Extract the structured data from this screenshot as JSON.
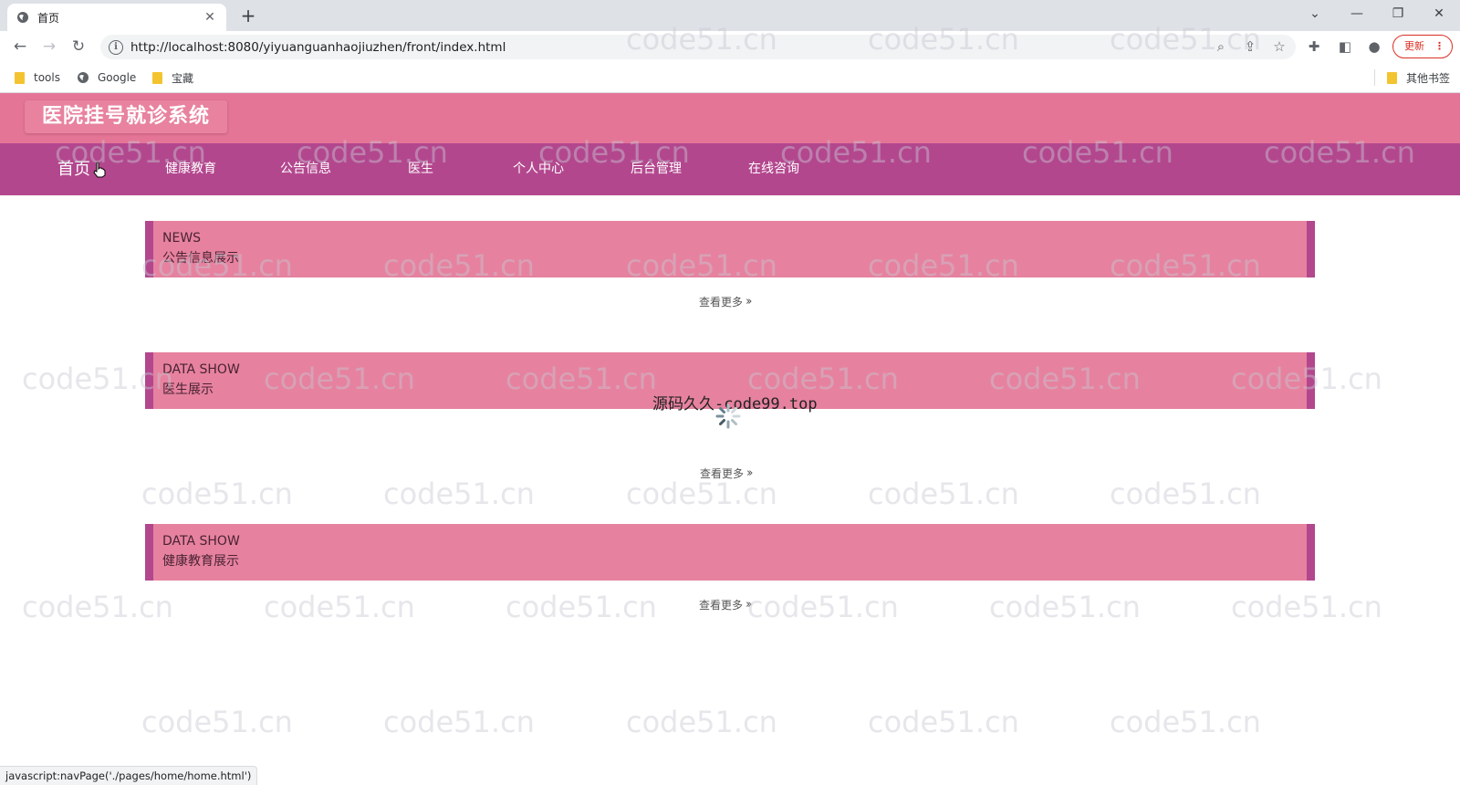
{
  "browser": {
    "tab_title": "首页",
    "tab_close": "✕",
    "new_tab": "+",
    "url": "http://localhost:8080/yiyuanguanhaojiuzhen/front/index.html",
    "update_label": "更新",
    "update_menu": "⋮",
    "bookmarks": [
      "tools",
      "Google",
      "宝藏"
    ],
    "other_bookmarks": "其他书签",
    "status_url": "javascript:navPage('./pages/home/home.html')"
  },
  "site": {
    "title": "医院挂号就诊系统",
    "nav": [
      "首页",
      "健康教育",
      "公告信息",
      "医生",
      "个人中心",
      "后台管理",
      "在线咨询"
    ],
    "sections": [
      {
        "eyebrow": "NEWS",
        "title": "公告信息展示",
        "more": "查看更多"
      },
      {
        "eyebrow": "DATA SHOW",
        "title": "医生展示",
        "more": "查看更多"
      },
      {
        "eyebrow": "DATA SHOW",
        "title": "健康教育展示",
        "more": "查看更多"
      }
    ],
    "overlay_cn": "源码久久",
    "overlay_en": "-code99.top",
    "watermark": "code51.cn"
  },
  "colors": {
    "header": "#e57597",
    "nav": "#b3478e",
    "section_bar": "#e6829f"
  }
}
